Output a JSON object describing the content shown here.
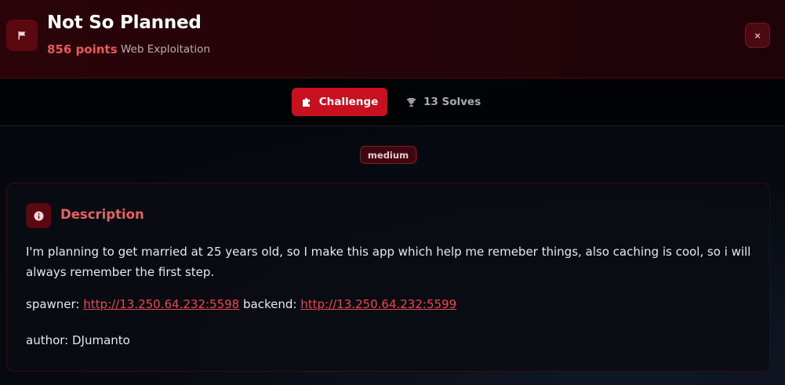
{
  "header": {
    "title": "Not So Planned",
    "points": "856 points",
    "category": "Web Exploitation",
    "close_label": "×",
    "icon": "flag-icon"
  },
  "tabs": {
    "challenge_label": "Challenge",
    "challenge_icon": "puzzle-icon",
    "solves_label": "13 Solves",
    "solves_icon": "trophy-icon"
  },
  "difficulty": "medium",
  "description": {
    "title": "Description",
    "icon": "info-icon",
    "text": "I'm planning to get married at 25 years old, so I make this app which help me remeber things, also caching is cool, so i will always remember the first step.",
    "spawner_label": "spawner:",
    "spawner_url": "http://13.250.64.232:5598",
    "backend_label": "backend:",
    "backend_url": "http://13.250.64.232:5599",
    "author": "author: DJumanto"
  },
  "colors": {
    "accent": "#c8101e",
    "accent_text": "#e55a5a",
    "link": "#e5484d"
  }
}
